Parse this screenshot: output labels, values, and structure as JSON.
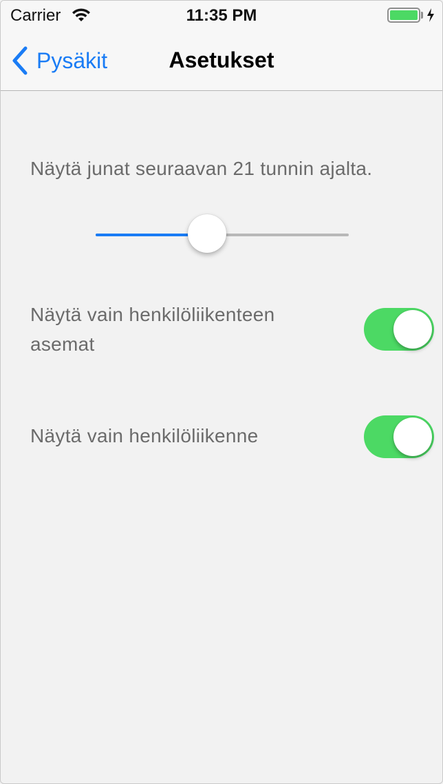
{
  "status_bar": {
    "carrier": "Carrier",
    "time": "11:35 PM",
    "battery_level": 1.0
  },
  "nav": {
    "back_label": "Pysäkit",
    "title": "Asetukset"
  },
  "settings": {
    "hours_label": "Näytä junat seuraavan 21 tunnin ajalta.",
    "hours_slider_fraction": 0.44,
    "passenger_stations_label": "Näytä vain henkilöliikenteen asemat",
    "passenger_stations_on": true,
    "passenger_traffic_label": "Näytä vain henkilöliikenne",
    "passenger_traffic_on": true
  },
  "colors": {
    "accent": "#1a7cf5",
    "toggle_on": "#4cd964",
    "battery": "#4cd964",
    "label_text": "#6b6b6b",
    "background": "#f2f2f2"
  }
}
